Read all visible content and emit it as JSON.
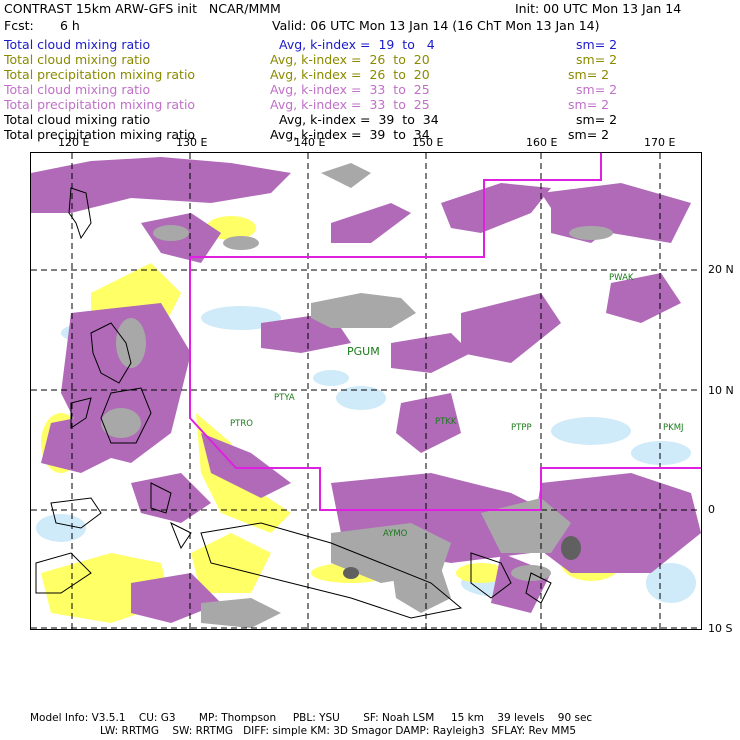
{
  "header": {
    "title": "CONTRAST 15km ARW-GFS init   NCAR/MMM",
    "init": "Init: 00 UTC Mon 13 Jan 14",
    "fcst_label": "Fcst:",
    "fcst_value": "6 h",
    "valid": "Valid: 06 UTC Mon 13 Jan 14 (16 ChT Mon 13 Jan 14)"
  },
  "fields": [
    {
      "name": "Total cloud mixing ratio",
      "avg": "Avg, k-index =  19  to   4",
      "sm": "sm= 2",
      "color": "#1a1acc"
    },
    {
      "name": "Total cloud mixing ratio",
      "avg": "Avg, k-index =  26  to  20",
      "sm": "sm= 2",
      "color": "#8a8a00"
    },
    {
      "name": "Total precipitation mixing ratio",
      "avg": "Avg, k-index =  26  to  20",
      "sm": "sm= 2",
      "color": "#8a8a00"
    },
    {
      "name": "Total cloud mixing ratio",
      "avg": "Avg, k-index =  33  to  25",
      "sm": "sm= 2",
      "color": "#c070c8"
    },
    {
      "name": "Total precipitation mixing ratio",
      "avg": "Avg, k-index =  33  to  25",
      "sm": "sm= 2",
      "color": "#c070c8"
    },
    {
      "name": "Total cloud mixing ratio",
      "avg": "Avg, k-index =  39  to  34",
      "sm": "sm= 2",
      "color": "#000000"
    },
    {
      "name": "Total precipitation mixing ratio",
      "avg": "Avg, k-index =  39  to  34",
      "sm": "sm= 2",
      "color": "#000000"
    }
  ],
  "map": {
    "lon_labels": [
      "120 E",
      "130 E",
      "140 E",
      "150 E",
      "160 E",
      "170 E"
    ],
    "lat_labels": [
      "20 N",
      "10 N",
      "0",
      "10 S"
    ],
    "stations": [
      "PWAK",
      "PGUM",
      "PTYA",
      "PTRO",
      "PTKK",
      "PTPP",
      "PKMJ",
      "AYMO"
    ],
    "colors": {
      "magenta": "#b06ab8",
      "gray": "#a0a0a0",
      "yellow": "#ffff55",
      "lightblue": "#cfeaf8",
      "boundary": "#e020e0"
    }
  },
  "footer": {
    "line1": "Model Info: V3.5.1    CU: G3       MP: Thompson     PBL: YSU       SF: Noah LSM     15 km    39 levels    90 sec",
    "line2": "LW: RRTMG    SW: RRTMG   DIFF: simple KM: 3D Smagor DAMP: Rayleigh3  SFLAY: Rev MM5"
  }
}
